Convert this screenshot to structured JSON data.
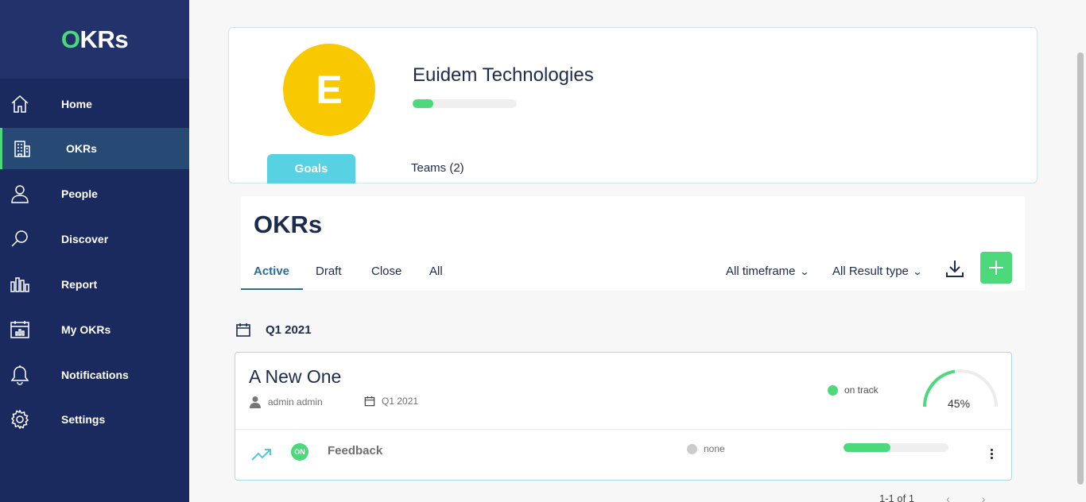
{
  "app": {
    "logo_first": "O",
    "logo_rest": "KRs"
  },
  "sidebar": {
    "items": [
      {
        "label": "Home",
        "icon": "home-icon"
      },
      {
        "label": "OKRs",
        "icon": "building-icon",
        "active": true
      },
      {
        "label": "People",
        "icon": "person-icon"
      },
      {
        "label": "Discover",
        "icon": "search-icon"
      },
      {
        "label": "Report",
        "icon": "bar-chart-icon"
      },
      {
        "label": "My OKRs",
        "icon": "calendar-chart-icon"
      },
      {
        "label": "Notifications",
        "icon": "bell-icon"
      },
      {
        "label": "Settings",
        "icon": "gear-icon"
      }
    ]
  },
  "profile": {
    "avatar_letter": "E",
    "avatar_color": "#f8c800",
    "org_name": "Euidem Technologies",
    "progress_fraction": 0.2,
    "tabs": [
      {
        "label": "Goals",
        "active": true
      },
      {
        "label": "Teams (2)"
      }
    ]
  },
  "okrs": {
    "title": "OKRs",
    "filter_tabs": [
      "Active",
      "Draft",
      "Close",
      "All"
    ],
    "active_filter": "Active",
    "timeframe_dropdown": "All timeframe",
    "result_type_dropdown": "All Result type",
    "download_icon": "download-icon",
    "add_icon": "plus-icon"
  },
  "quarter": {
    "label": "Q1 2021"
  },
  "objective": {
    "title": "A New One",
    "owner": "admin admin",
    "period": "Q1 2021",
    "status": "on track",
    "progress_percent": 45,
    "progress_label": "45%",
    "key_result": {
      "badge": "ON",
      "name": "Feedback",
      "status": "none",
      "progress_fraction": 0.45
    }
  },
  "pagination": {
    "range": "1-1 of 1",
    "prev": "‹",
    "next": "›"
  },
  "colors": {
    "sidebar": "#1b2a5e",
    "accent_green": "#4cd97b",
    "goals_tab": "#57d2e2",
    "text_dark": "#1d2b4f"
  }
}
